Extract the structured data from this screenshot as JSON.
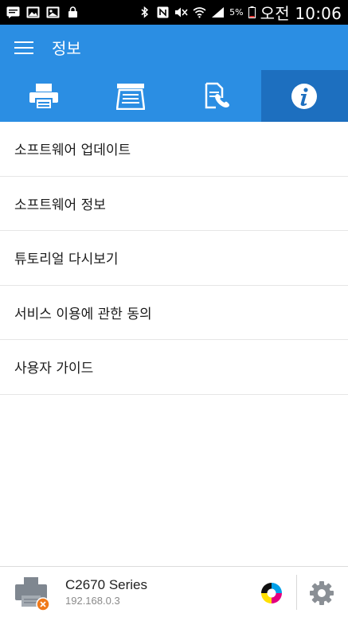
{
  "status_bar": {
    "battery_percent": "5%",
    "time": "오전 10:06",
    "left_icons": [
      "message-icon",
      "image-icon",
      "gallery-icon",
      "lock-icon"
    ],
    "right_icons": [
      "bluetooth-icon",
      "nfc-icon",
      "mute-icon",
      "wifi-icon",
      "signal-icon",
      "battery-icon"
    ]
  },
  "app_bar": {
    "title": "정보",
    "color": "#2b8ee3"
  },
  "tabs": [
    {
      "name": "print",
      "icon": "printer-icon",
      "active": false
    },
    {
      "name": "scan",
      "icon": "scanner-icon",
      "active": false
    },
    {
      "name": "fax",
      "icon": "fax-icon",
      "active": false
    },
    {
      "name": "info",
      "icon": "info-icon",
      "active": true
    }
  ],
  "menu": {
    "items": [
      {
        "label": "소프트웨어 업데이트"
      },
      {
        "label": "소프트웨어 정보"
      },
      {
        "label": "튜토리얼 다시보기"
      },
      {
        "label": "서비스 이용에 관한 동의"
      },
      {
        "label": "사용자 가이드"
      }
    ]
  },
  "printer": {
    "name": "C2670 Series",
    "ip": "192.168.0.3",
    "status_color": "#f07a1a"
  }
}
